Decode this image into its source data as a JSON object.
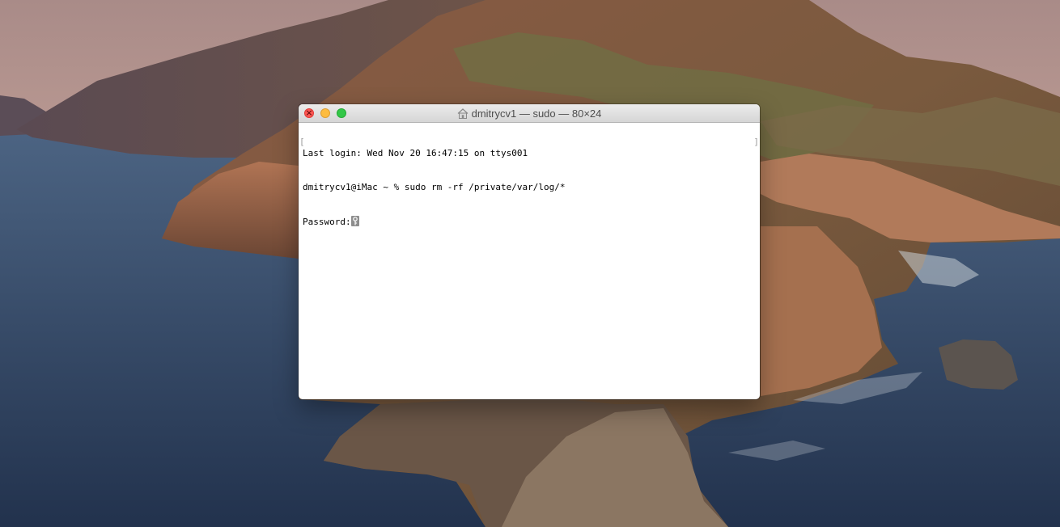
{
  "desktop": {
    "wallpaper": "macOS Catalina island wallpaper"
  },
  "terminal": {
    "title": "dmitrycv1 — sudo — 80×24",
    "title_icon": "home-folder-icon",
    "lines": [
      "Last login: Wed Nov 20 16:47:15 on ttys001",
      "dmitrycv1@iMac ~ % sudo rm -rf /private/var/log/*",
      "Password:"
    ],
    "cursor_icon": "key-icon",
    "buttons": {
      "close_color": "#fc5753",
      "minimize_color": "#fdbc40",
      "zoom_color": "#33c748"
    }
  }
}
